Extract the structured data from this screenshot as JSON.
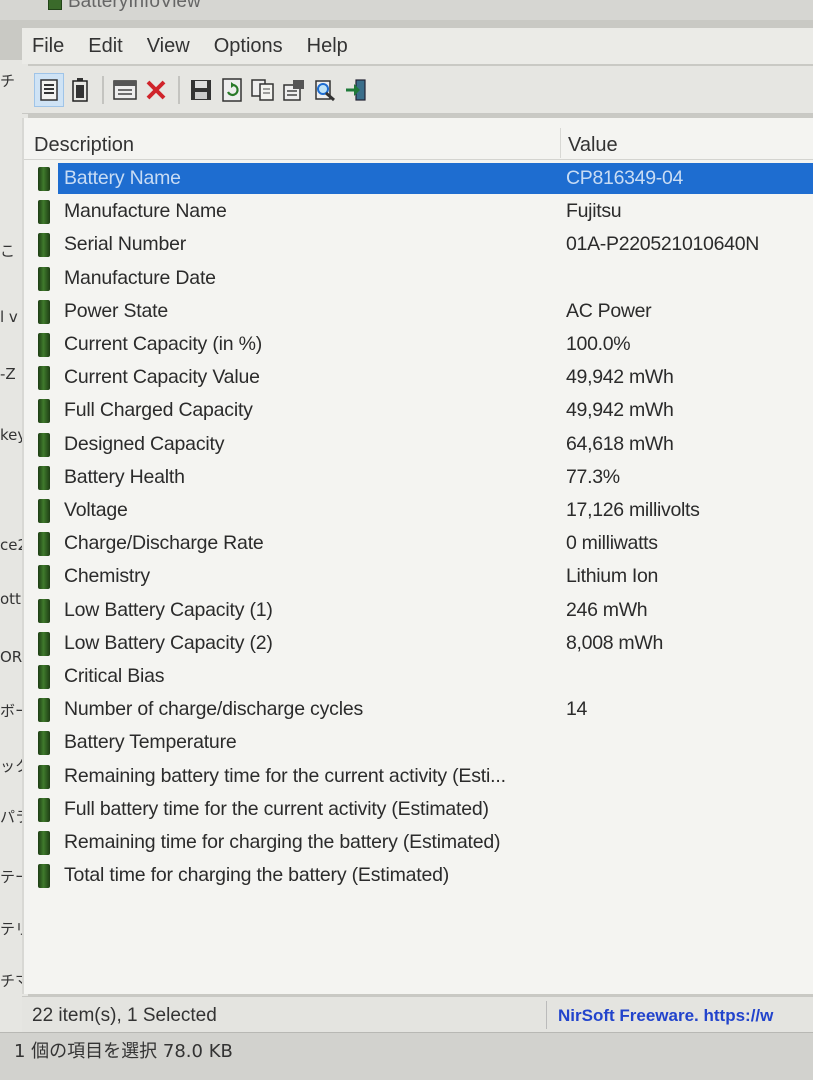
{
  "window": {
    "title": "BatteryInfoView"
  },
  "menu": [
    "File",
    "Edit",
    "View",
    "Options",
    "Help"
  ],
  "toolbar": [
    {
      "icon": "properties-icon",
      "active": true
    },
    {
      "icon": "battery-info-icon",
      "active": false
    },
    {
      "sep": true
    },
    {
      "icon": "log-window-icon",
      "active": false
    },
    {
      "icon": "delete-x-icon",
      "active": false
    },
    {
      "sep": true
    },
    {
      "icon": "save-icon",
      "active": false
    },
    {
      "icon": "refresh-icon",
      "active": false
    },
    {
      "icon": "copy-icon",
      "active": false
    },
    {
      "icon": "html-report-icon",
      "active": false
    },
    {
      "icon": "find-icon",
      "active": false
    },
    {
      "icon": "exit-icon",
      "active": false
    }
  ],
  "list": {
    "columns": {
      "description": "Description",
      "value": "Value"
    },
    "rows": [
      {
        "description": "Battery Name",
        "value": "CP816349-04",
        "selected": true
      },
      {
        "description": "Manufacture Name",
        "value": "Fujitsu"
      },
      {
        "description": "Serial Number",
        "value": "01A-P220521010640N"
      },
      {
        "description": "Manufacture Date",
        "value": ""
      },
      {
        "description": "Power State",
        "value": "AC Power"
      },
      {
        "description": "Current Capacity (in %)",
        "value": "100.0%"
      },
      {
        "description": "Current Capacity Value",
        "value": "49,942 mWh"
      },
      {
        "description": "Full Charged Capacity",
        "value": "49,942 mWh"
      },
      {
        "description": "Designed Capacity",
        "value": "64,618 mWh"
      },
      {
        "description": "Battery Health",
        "value": "77.3%"
      },
      {
        "description": "Voltage",
        "value": "17,126 millivolts"
      },
      {
        "description": "Charge/Discharge Rate",
        "value": "0 milliwatts"
      },
      {
        "description": "Chemistry",
        "value": "Lithium Ion"
      },
      {
        "description": "Low Battery Capacity (1)",
        "value": "246 mWh"
      },
      {
        "description": "Low Battery Capacity (2)",
        "value": "8,008 mWh"
      },
      {
        "description": "Critical Bias",
        "value": ""
      },
      {
        "description": "Number of charge/discharge cycles",
        "value": "14"
      },
      {
        "description": "Battery Temperature",
        "value": ""
      },
      {
        "description": "Remaining battery time for the current activity (Esti...",
        "value": ""
      },
      {
        "description": "Full battery time for the current activity (Estimated)",
        "value": ""
      },
      {
        "description": "Remaining time for charging the battery (Estimated)",
        "value": ""
      },
      {
        "description": "Total  time for charging the battery (Estimated)",
        "value": ""
      }
    ]
  },
  "status": {
    "count": "22 item(s), 1 Selected",
    "credit": "NirSoft Freeware. https://w"
  },
  "explorer_status": "1 個の項目を選択  78.0 KB",
  "background_fragments": [
    "チ",
    "こ",
    "l v",
    "-Z",
    "key",
    "ce2",
    "ottl",
    "ORH",
    "ボー",
    "ック",
    "パラ",
    "テー",
    "テリ",
    "チマ"
  ],
  "colors": {
    "selection": "#1e6dd0",
    "battery_icon": "#2f5e22",
    "credit_link": "#2244cc"
  }
}
